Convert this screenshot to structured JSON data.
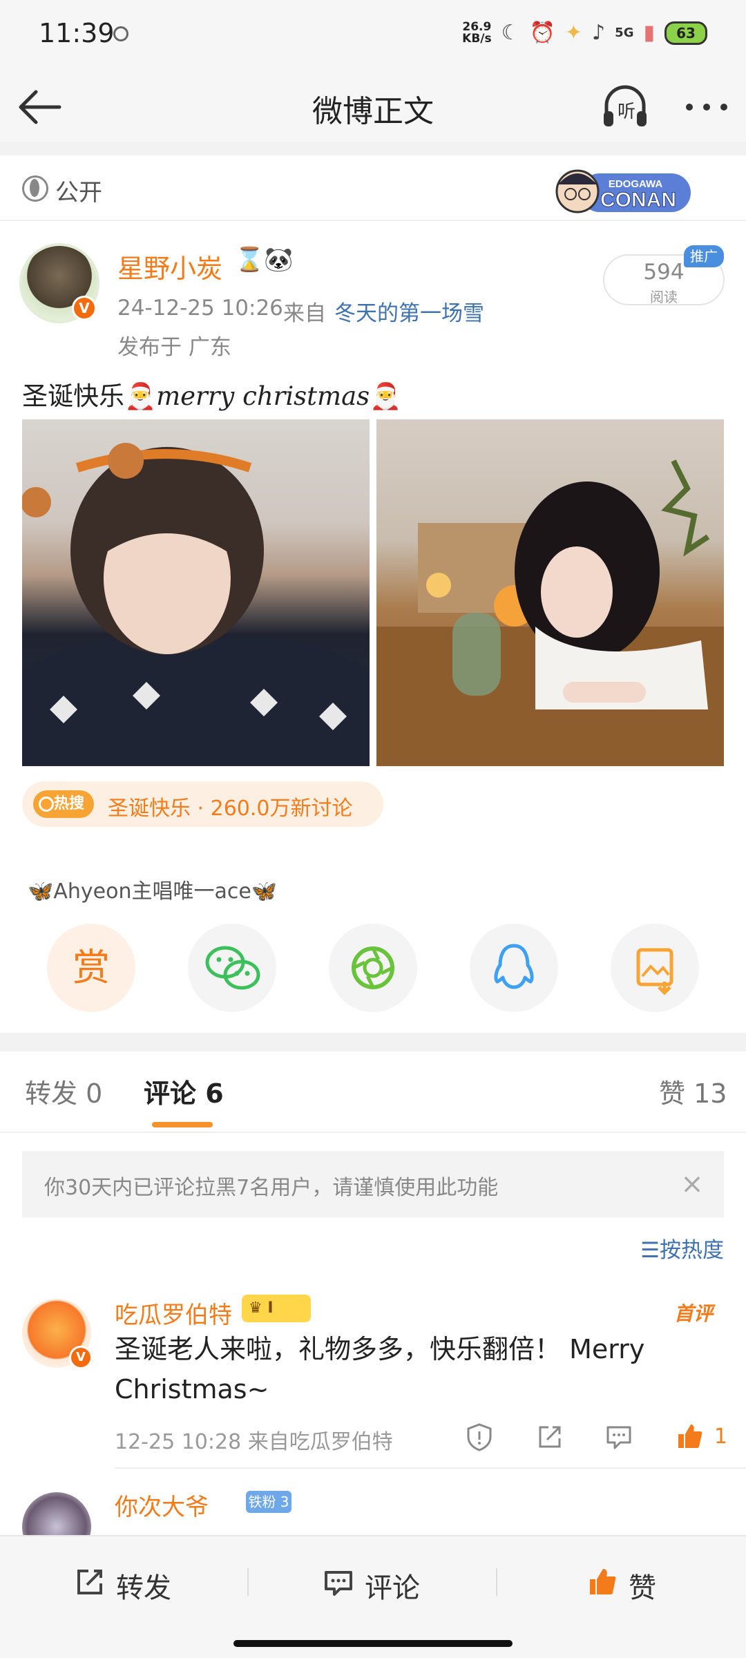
{
  "status_bar": {
    "time": "11:39",
    "net_speed_value": "26.9",
    "net_speed_unit": "KB/s",
    "network": "5G",
    "battery": "63"
  },
  "nav": {
    "title": "微博正文",
    "listen_label": "听"
  },
  "post": {
    "visibility": "公开",
    "author": {
      "name": "星野小炭",
      "name_emoji": "⌛🐼",
      "verified_badge": "V"
    },
    "time": "24-12-25 10:26",
    "from_prefix": "来自",
    "source": "冬天的第一场雪",
    "location": "发布于 广东",
    "read_count": "594",
    "read_label": "阅读",
    "promo_tag": "推广",
    "text_prefix": "圣诞快乐🎅",
    "text_script": "merry christmas",
    "text_suffix": "🎅",
    "hot_topic": {
      "badge": "热搜",
      "text": "圣诞快乐 · 260.0万新讨论"
    },
    "reward_label": "🦋Ahyeon主唱唯一ace🦋",
    "share_buttons": [
      {
        "name": "reward",
        "glyph": "赏",
        "color": "#f47b1a"
      },
      {
        "name": "wechat",
        "glyph": "💬",
        "color": "#3cc05b"
      },
      {
        "name": "moments",
        "glyph": "◎",
        "color": "#69c33b"
      },
      {
        "name": "qq",
        "glyph": "🐧",
        "color": "#3ea0f0"
      },
      {
        "name": "save-image",
        "glyph": "⇩",
        "color": "#f7a435"
      }
    ]
  },
  "tabs": {
    "repost": "转发 0",
    "comments": "评论 6",
    "likes": "赞 13"
  },
  "notice": {
    "text": "你30天内已评论拉黑7名用户，请谨慎使用此功能",
    "close": "×"
  },
  "sort_label": "按热度",
  "comments": [
    {
      "name": "吃瓜罗伯特",
      "badge": "I",
      "tag": "首评",
      "text": "圣诞老人来啦，礼物多多，快乐翻倍！ Merry Christmas~",
      "meta": "12-25 10:28  来自吃瓜罗伯特",
      "likes": "1"
    },
    {
      "name": "你次大爷",
      "fan_badge": "铁粉 3"
    }
  ],
  "bottom": {
    "repost": "转发",
    "comment": "评论",
    "like": "赞"
  },
  "colors": {
    "accent_orange": "#f47b1a",
    "link_blue": "#3f72af",
    "promo_blue": "#4a8ee0"
  }
}
